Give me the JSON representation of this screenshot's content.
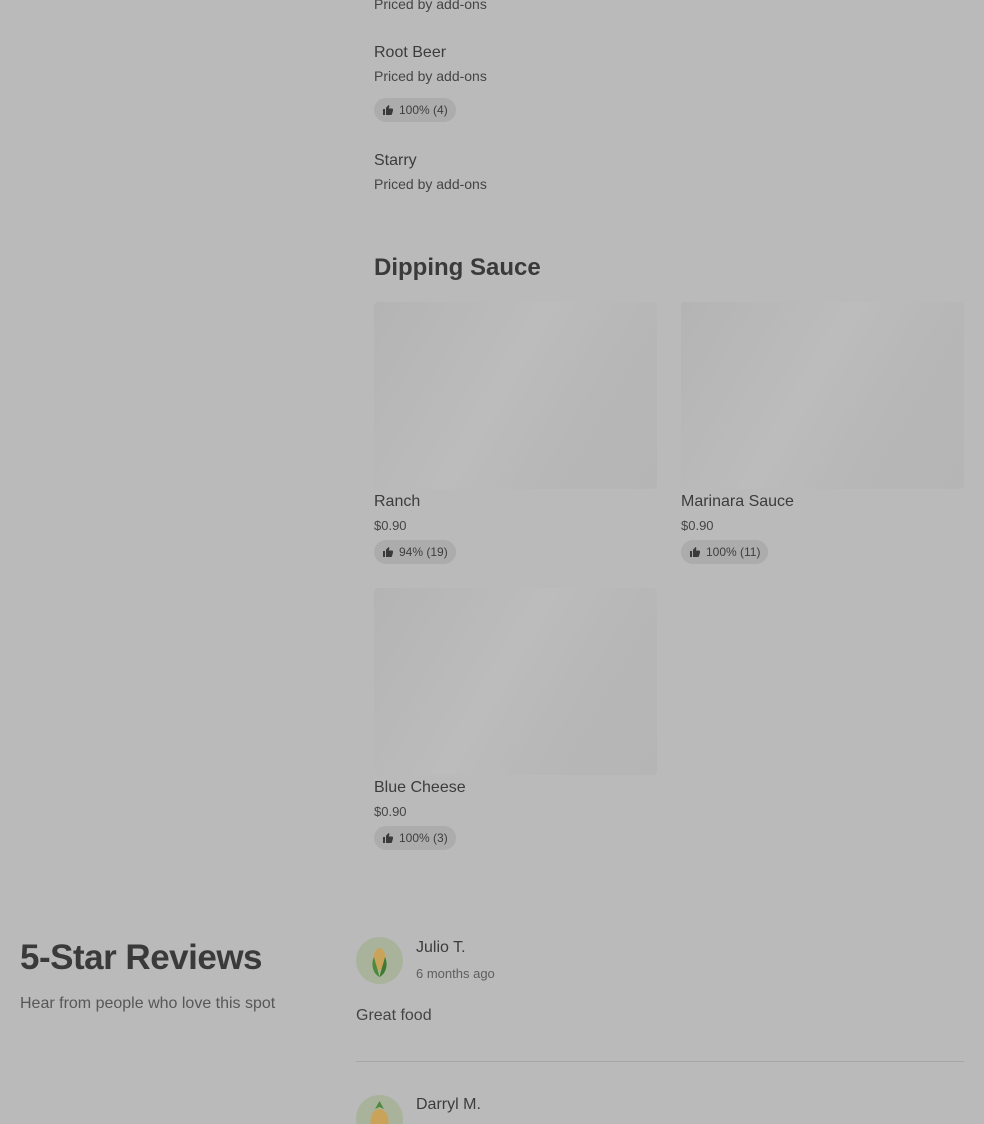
{
  "drinks": {
    "items": [
      {
        "name": "",
        "sub": "Priced by add-ons"
      },
      {
        "name": "Root Beer",
        "sub": "Priced by add-ons",
        "rating": "100% (4)"
      },
      {
        "name": "Starry",
        "sub": "Priced by add-ons"
      }
    ]
  },
  "dipping_sauce": {
    "title": "Dipping Sauce",
    "items": [
      {
        "name": "Ranch",
        "price": "$0.90",
        "rating": "94% (19)"
      },
      {
        "name": "Marinara Sauce",
        "price": "$0.90",
        "rating": "100% (11)"
      },
      {
        "name": "Blue Cheese",
        "price": "$0.90",
        "rating": "100% (3)"
      }
    ]
  },
  "reviews": {
    "title": "5-Star Reviews",
    "subtitle": "Hear from people who love this spot",
    "items": [
      {
        "name": "Julio T.",
        "date": "6 months ago",
        "text": "Great food",
        "avatar_icon": "corn-icon"
      },
      {
        "name": "Darryl M.",
        "avatar_icon": "pineapple-icon"
      }
    ]
  },
  "colors": {
    "overlay_bg": "#bababa",
    "badge_bg": "#acacac",
    "avatar_bg": "#a9b39c"
  }
}
